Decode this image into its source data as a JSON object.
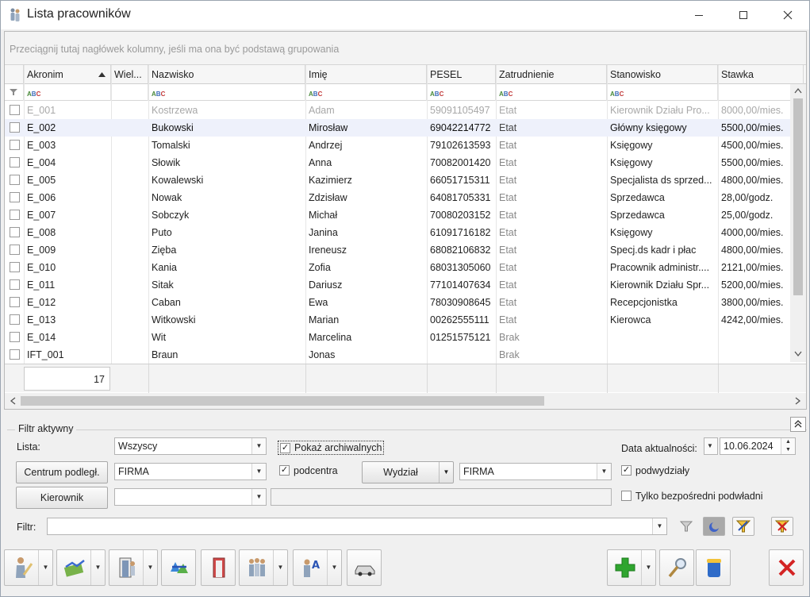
{
  "window": {
    "title": "Lista pracowników"
  },
  "grid": {
    "group_hint": "Przeciągnij tutaj nagłówek kolumny, jeśli ma ona być podstawą grupowania",
    "columns": [
      "Akronim",
      "Wiel...",
      "Nazwisko",
      "Imię",
      "PESEL",
      "Zatrudnienie",
      "Stanowisko",
      "Stawka"
    ],
    "filter_icon_text": "ABC",
    "rows": [
      {
        "akronim": "E_001",
        "nazwisko": "Kostrzewa",
        "imie": "Adam",
        "pesel": "59091105497",
        "zatrudnienie": "Etat",
        "stanowisko": "Kierownik Działu Pro...",
        "stawka": "8000,00/mies.",
        "archived": true
      },
      {
        "akronim": "E_002",
        "nazwisko": "Bukowski",
        "imie": "Mirosław",
        "pesel": "69042214772",
        "zatrudnienie": "Etat",
        "stanowisko": "Główny księgowy",
        "stawka": "5500,00/mies.",
        "selected": true
      },
      {
        "akronim": "E_003",
        "nazwisko": "Tomalski",
        "imie": "Andrzej",
        "pesel": "79102613593",
        "zatrudnienie": "Etat",
        "stanowisko": "Księgowy",
        "stawka": "4500,00/mies."
      },
      {
        "akronim": "E_004",
        "nazwisko": "Słowik",
        "imie": "Anna",
        "pesel": "70082001420",
        "zatrudnienie": "Etat",
        "stanowisko": "Księgowy",
        "stawka": "5500,00/mies."
      },
      {
        "akronim": "E_005",
        "nazwisko": "Kowalewski",
        "imie": "Kazimierz",
        "pesel": "66051715311",
        "zatrudnienie": "Etat",
        "stanowisko": "Specjalista ds sprzed...",
        "stawka": "4800,00/mies."
      },
      {
        "akronim": "E_006",
        "nazwisko": "Nowak",
        "imie": "Zdzisław",
        "pesel": "64081705331",
        "zatrudnienie": "Etat",
        "stanowisko": "Sprzedawca",
        "stawka": "28,00/godz."
      },
      {
        "akronim": "E_007",
        "nazwisko": "Sobczyk",
        "imie": "Michał",
        "pesel": "70080203152",
        "zatrudnienie": "Etat",
        "stanowisko": "Sprzedawca",
        "stawka": "25,00/godz."
      },
      {
        "akronim": "E_008",
        "nazwisko": "Puto",
        "imie": "Janina",
        "pesel": "61091716182",
        "zatrudnienie": "Etat",
        "stanowisko": "Księgowy",
        "stawka": "4000,00/mies."
      },
      {
        "akronim": "E_009",
        "nazwisko": "Zięba",
        "imie": "Ireneusz",
        "pesel": "68082106832",
        "zatrudnienie": "Etat",
        "stanowisko": "Specj.ds kadr i płac",
        "stawka": "4800,00/mies."
      },
      {
        "akronim": "E_010",
        "nazwisko": "Kania",
        "imie": "Zofia",
        "pesel": "68031305060",
        "zatrudnienie": "Etat",
        "stanowisko": "Pracownik administr....",
        "stawka": "2121,00/mies."
      },
      {
        "akronim": "E_011",
        "nazwisko": "Sitak",
        "imie": "Dariusz",
        "pesel": "77101407634",
        "zatrudnienie": "Etat",
        "stanowisko": "Kierownik Działu Spr...",
        "stawka": "5200,00/mies."
      },
      {
        "akronim": "E_012",
        "nazwisko": "Caban",
        "imie": "Ewa",
        "pesel": "78030908645",
        "zatrudnienie": "Etat",
        "stanowisko": "Recepcjonistka",
        "stawka": "3800,00/mies."
      },
      {
        "akronim": "E_013",
        "nazwisko": "Witkowski",
        "imie": "Marian",
        "pesel": "00262555111",
        "zatrudnienie": "Etat",
        "stanowisko": "Kierowca",
        "stawka": "4242,00/mies."
      },
      {
        "akronim": "E_014",
        "nazwisko": "Wit",
        "imie": "Marcelina",
        "pesel": "01251575121",
        "zatrudnienie": "Brak",
        "stanowisko": "",
        "stawka": ""
      },
      {
        "akronim": "IFT_001",
        "nazwisko": "Braun",
        "imie": "Jonas",
        "pesel": "",
        "zatrudnienie": "Brak",
        "stanowisko": "",
        "stawka": ""
      }
    ],
    "footer_count": "17"
  },
  "filter": {
    "legend": "Filtr aktywny",
    "lista_label": "Lista:",
    "lista_value": "Wszyscy",
    "pokaz_archiwalnych": "Pokaż archiwalnych",
    "data_label": "Data aktualności:",
    "data_value": "10.06.2024",
    "centrum_btn": "Centrum podległ.",
    "centrum_value": "FIRMA",
    "podcentra": "podcentra",
    "wydzial_btn": "Wydział",
    "wydzial_value": "FIRMA",
    "podwydzialy": "podwydziały",
    "kierownik_btn": "Kierownik",
    "kierownik_value": "",
    "tylko": "Tylko bezpośredni podwładni",
    "filtr_label": "Filtr:",
    "filtr_value": ""
  },
  "colors": {
    "selected_row": "#eef1fb",
    "add_green": "#2fa52f",
    "close_red": "#d42424"
  }
}
